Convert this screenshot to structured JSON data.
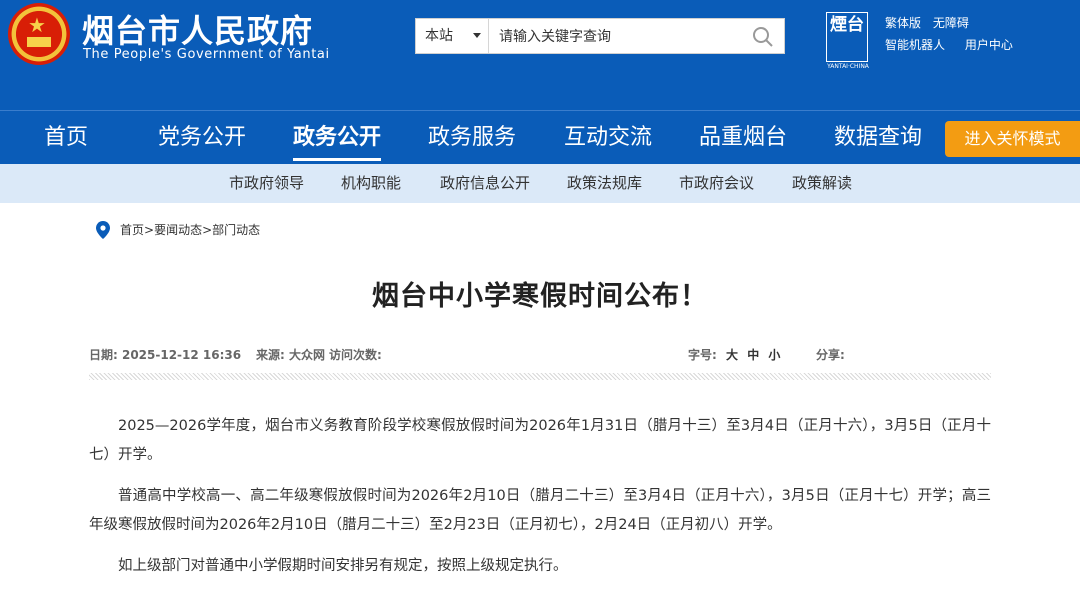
{
  "header": {
    "title": "烟台市人民政府",
    "subtitle": "The People's Government of Yantai",
    "search": {
      "scope": "本站",
      "placeholder": "请输入关键字查询"
    },
    "seal": {
      "chars": "煙台",
      "footer": "YANTAI·CHINA"
    },
    "links_row1": [
      "繁体版",
      "无障碍"
    ],
    "links_row2": [
      "智能机器人",
      "用户中心"
    ]
  },
  "nav": {
    "items": [
      "首页",
      "党务公开",
      "政务公开",
      "政务服务",
      "互动交流",
      "品重烟台",
      "数据查询"
    ],
    "active": "政务公开",
    "care_mode_label": "进入关怀模式"
  },
  "subnav": {
    "items": [
      "市政府领导",
      "机构职能",
      "政府信息公开",
      "政策法规库",
      "市政府会议",
      "政策解读"
    ]
  },
  "breadcrumb": [
    "首页",
    "要闻动态",
    "部门动态"
  ],
  "article": {
    "title": "烟台中小学寒假时间公布！",
    "date_label": "日期: 2025-12-12 16:36",
    "source_label": "来源: 大众网",
    "visits_label": "访问次数:",
    "font_size_label": "字号:",
    "font_sizes": [
      "大",
      "中",
      "小"
    ],
    "share_label": "分享:",
    "paragraphs": [
      "2025—2026学年度，烟台市义务教育阶段学校寒假放假时间为2026年1月31日（腊月十三）至3月4日（正月十六），3月5日（正月十七）开学。",
      "普通高中学校高一、高二年级寒假放假时间为2026年2月10日（腊月二十三）至3月4日（正月十六），3月5日（正月十七）开学；高三年级寒假放假时间为2026年2月10日（腊月二十三）至2月23日（正月初七），2月24日（正月初八）开学。",
      "如上级部门对普通中小学假期时间安排另有规定，按照上级规定执行。"
    ]
  },
  "colors": {
    "primary": "#0a5cb8",
    "subnav_bg": "#dbe9f8",
    "care_button": "#f39c12"
  }
}
